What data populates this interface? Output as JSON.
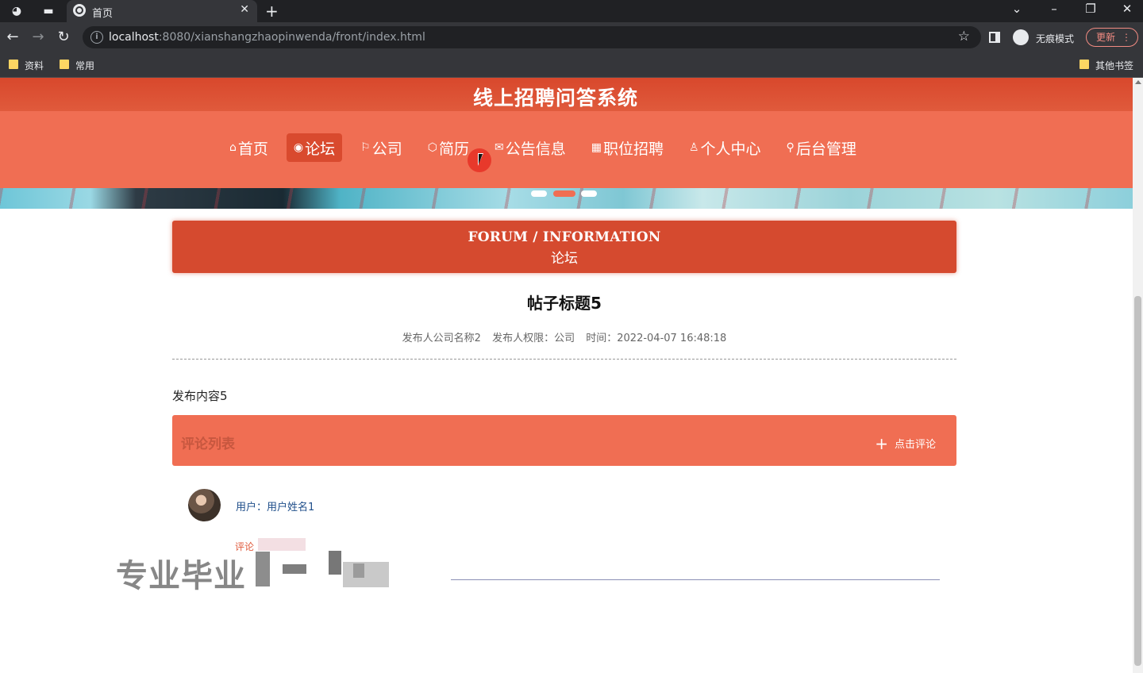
{
  "browser": {
    "tab_title": "首页",
    "url_host": "localhost",
    "url_rest": ":8080/xianshangzhaopinwenda/front/index.html",
    "incognito_label": "无痕模式",
    "update_label": "更新",
    "bookmarks": [
      "资料",
      "常用"
    ],
    "other_bookmarks": "其他书签"
  },
  "site": {
    "title": "线上招聘问答系统",
    "menu": [
      {
        "icon": "⌂",
        "label": "首页"
      },
      {
        "icon": "◉",
        "label": "论坛"
      },
      {
        "icon": "⚐",
        "label": "公司"
      },
      {
        "icon": "⬡",
        "label": "简历"
      },
      {
        "icon": "✉",
        "label": "公告信息"
      },
      {
        "icon": "▦",
        "label": "职位招聘"
      },
      {
        "icon": "♙",
        "label": "个人中心"
      },
      {
        "icon": "⚲",
        "label": "后台管理"
      }
    ],
    "active_menu": "论坛"
  },
  "section": {
    "title_en": "FORUM / INFORMATION",
    "title_cn": "论坛"
  },
  "post": {
    "title": "帖子标题5",
    "publisher": "发布人公司名称2",
    "role": "发布人权限：公司",
    "time": "时间：2022-04-07 16:48:18",
    "content": "发布内容5"
  },
  "comments": {
    "list_title": "评论列表",
    "add_label": "点击评论",
    "items": [
      {
        "user": "用户：用户姓名1",
        "label": "评论"
      }
    ]
  },
  "watermark": "专业毕业"
}
